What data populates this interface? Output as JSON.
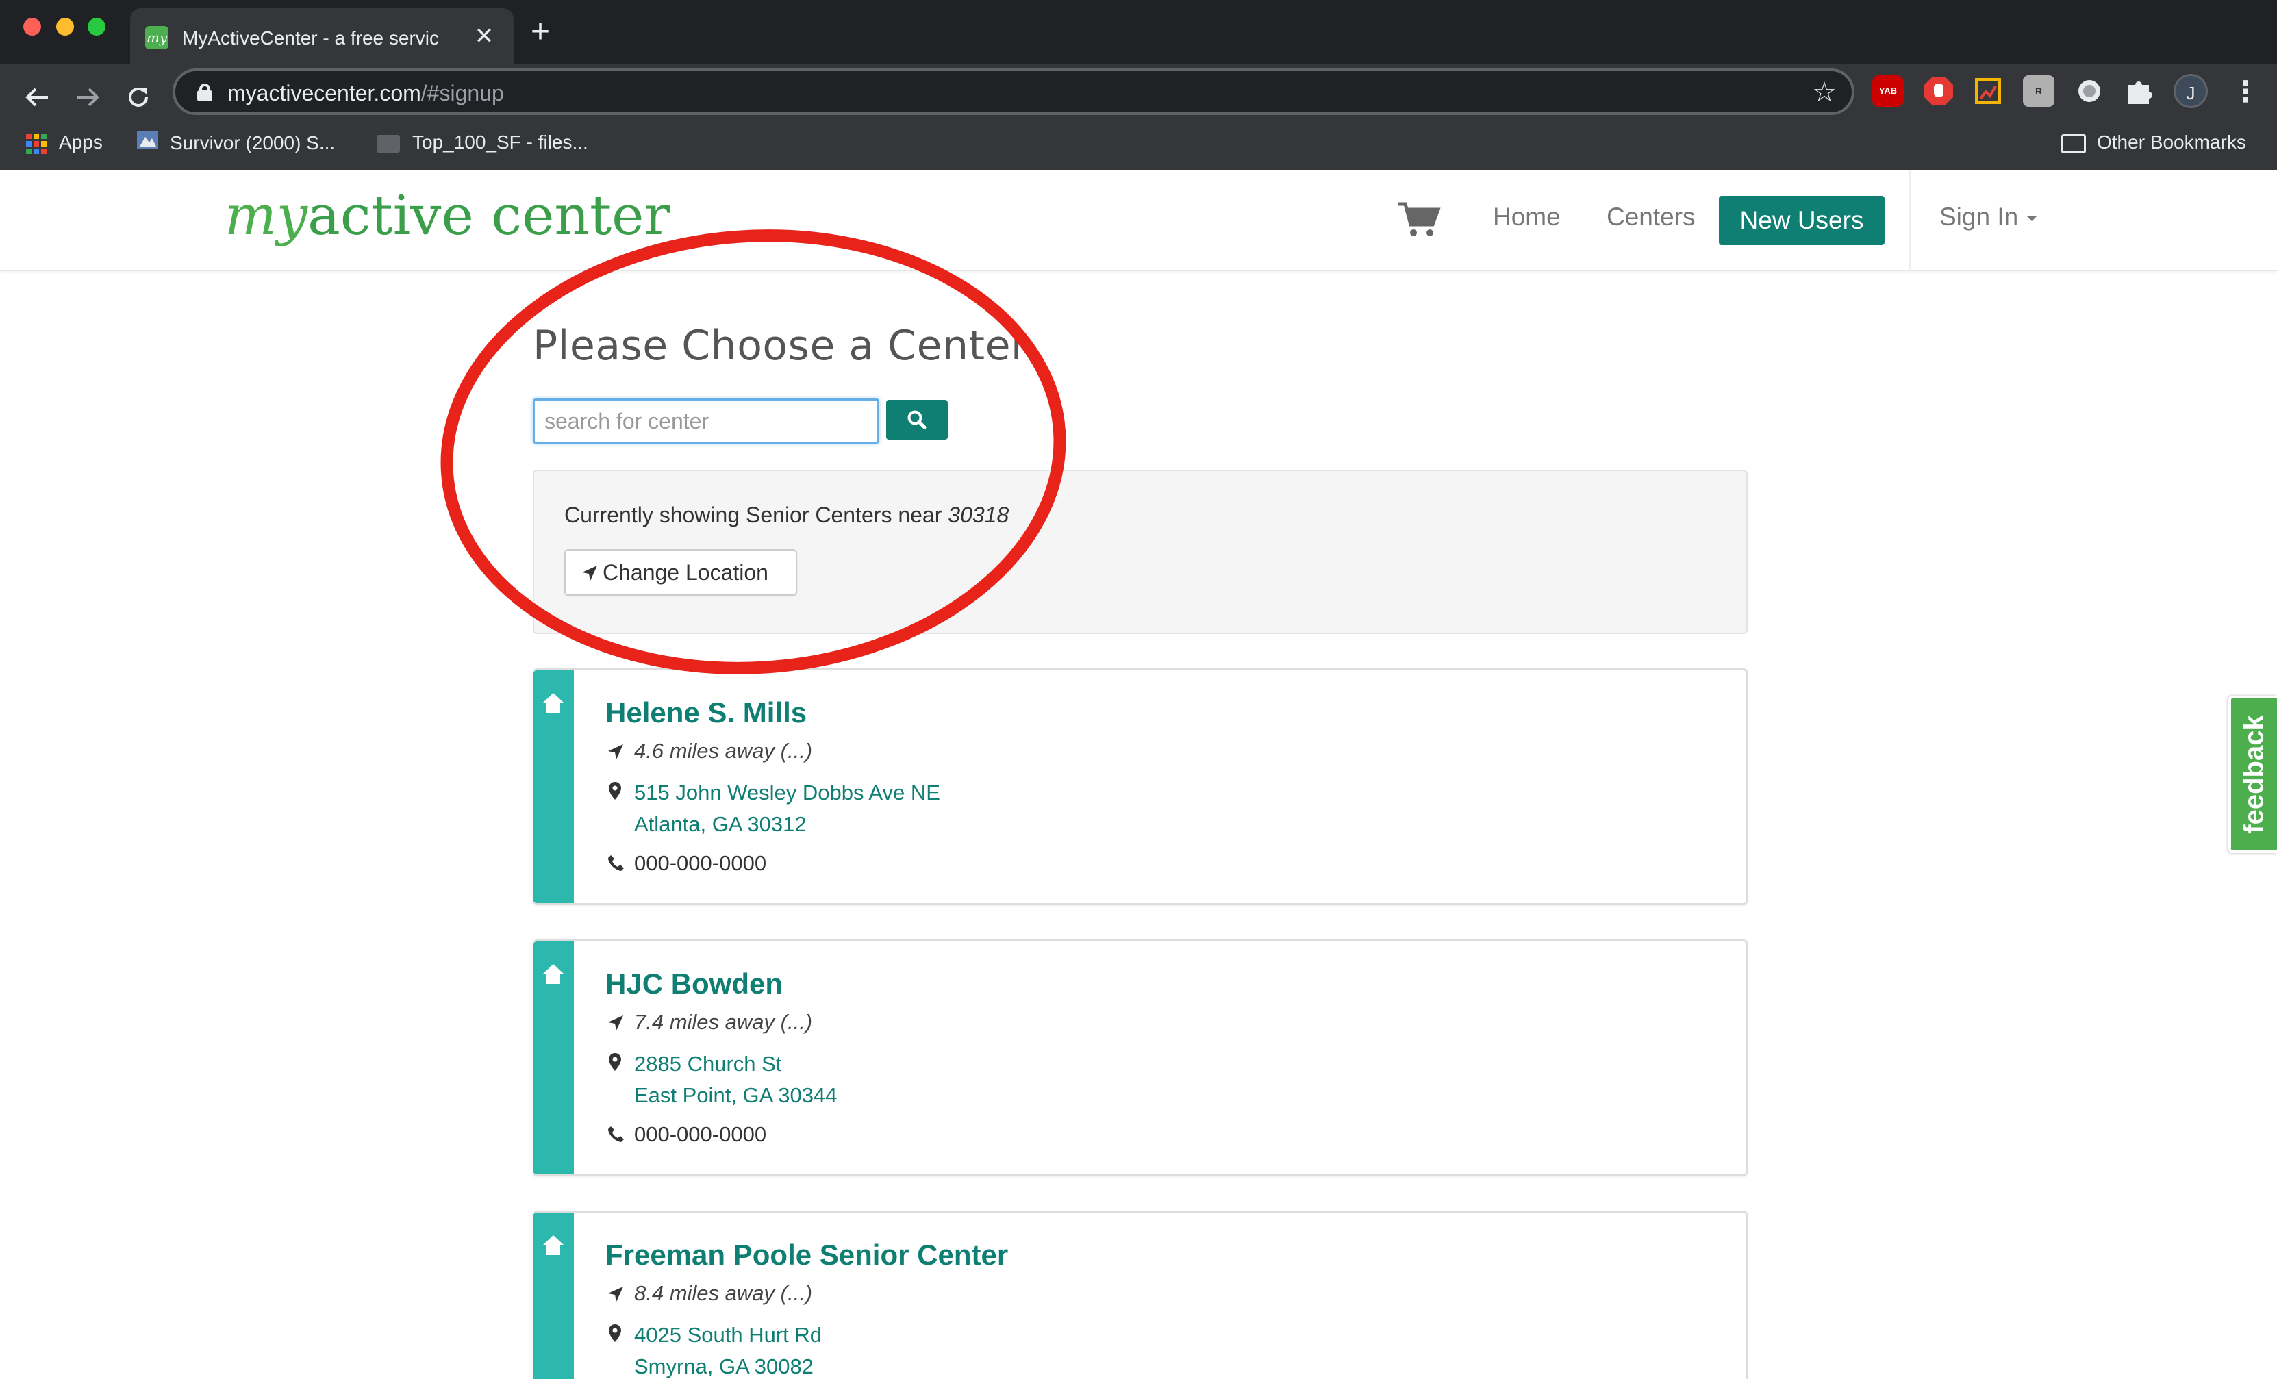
{
  "browser": {
    "tab_title": "MyActiveCenter - a free servic",
    "tab_favicon_text": "my",
    "tab_close": "✕",
    "new_tab": "+",
    "url_host": "myactivecenter.com",
    "url_path": "/#signup",
    "profile_initial": "J",
    "extensions": [
      "YAB",
      "adblock",
      "palette",
      "reader",
      "circle",
      "puzzle"
    ],
    "bookmarks": {
      "apps": "Apps",
      "items": [
        "Survivor (2000) S...",
        "Top_100_SF - files..."
      ],
      "other": "Other Bookmarks"
    }
  },
  "site": {
    "logo_my": "my",
    "logo_rest": "active center",
    "nav": {
      "home": "Home",
      "centers": "Centers",
      "new_users": "New Users",
      "sign_in": "Sign In"
    },
    "accent_color": "#0f7e73",
    "brand_green": "#4cae4c"
  },
  "main": {
    "title": "Please Choose a Center",
    "search": {
      "placeholder": "search for center",
      "value": ""
    },
    "location": {
      "text": "Currently showing Senior Centers near",
      "zip": "30318",
      "change_button": "Change Location"
    },
    "centers": [
      {
        "name": "Helene S. Mills",
        "distance": "4.6 miles away (...)",
        "address_line1": "515 John Wesley Dobbs Ave NE",
        "address_line2": "Atlanta, GA 30312",
        "phone": "000-000-0000"
      },
      {
        "name": "HJC Bowden",
        "distance": "7.4 miles away (...)",
        "address_line1": "2885 Church St",
        "address_line2": "East Point, GA 30344",
        "phone": "000-000-0000"
      },
      {
        "name": "Freeman Poole Senior Center",
        "distance": "8.4 miles away (...)",
        "address_line1": "4025 South Hurt Rd",
        "address_line2": "Smyrna, GA 30082",
        "phone": ""
      }
    ]
  },
  "feedback": "feedback",
  "annotation_color": "#e8231a"
}
